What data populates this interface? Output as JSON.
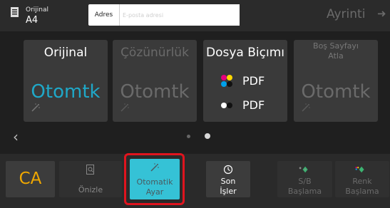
{
  "header": {
    "original_label": "Orijinal",
    "original_size": "A4",
    "address_button": "Adres",
    "email_placeholder": "E-posta adresi",
    "details_label": "Ayrinti",
    "details_arrow": "➜"
  },
  "settings": {
    "tiles": [
      {
        "title": "Orijinal",
        "value": "Otomtk"
      },
      {
        "title": "Çözünürlük",
        "value": "Otomtk"
      },
      {
        "title": "Dosya Biçımı",
        "formats": [
          "PDF",
          "PDF"
        ]
      },
      {
        "title_line1": "Boş Sayfayı",
        "title_line2": "Atla",
        "value": "Otomtk"
      }
    ],
    "prev_arrow": "‹",
    "page_count": 2
  },
  "actions": {
    "ca_label": "CA",
    "preview_label": "Önizle",
    "autoset_line1": "Otomatik",
    "autoset_line2": "Ayar",
    "lastjob_line1": "Son",
    "lastjob_line2": "İşler",
    "bw_line1": "S/B",
    "bw_line2": "Başlama",
    "color_line1": "Renk",
    "color_line2": "Başlama"
  },
  "colors": {
    "accent_cyan": "#35c2d6",
    "ca_orange": "#f0a800",
    "highlight_red": "#e0141e",
    "start_green": "#3cb371"
  }
}
